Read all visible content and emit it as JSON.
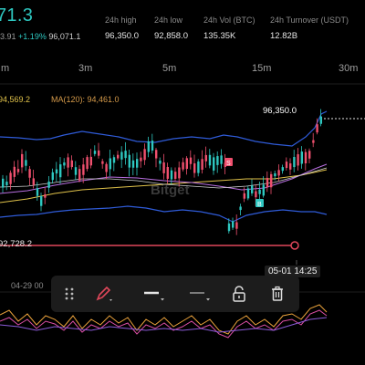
{
  "header": {
    "last_price": "71.3",
    "sub_prefix": "3.91",
    "change_pct": "+1.19%",
    "mark_price": "96,071.1",
    "stats": [
      {
        "label": "24h high",
        "value": "96,350.0"
      },
      {
        "label": "24h low",
        "value": "92,858.0"
      },
      {
        "label": "24h Vol (BTC)",
        "value": "135.35K"
      },
      {
        "label": "24h Turnover (USDT)",
        "value": "12.82B"
      }
    ]
  },
  "timeframes": [
    "m",
    "3m",
    "5m",
    "15m",
    "30m"
  ],
  "indicators": {
    "ma_a": "94,569.2",
    "ma_b": "MA(120): 94,461.0"
  },
  "chart": {
    "high_tag": "96,350.0",
    "low_tag": "92,728.2",
    "crosshair_time": "05-01 14:25",
    "axis_date": "04-29 00",
    "watermark": "Bitget",
    "colors": {
      "up": "#2ec7c0",
      "down": "#f0506e",
      "band": "#2f5bd8",
      "ma_yellow": "#e0c24a",
      "ma_purple": "#b86ee0",
      "line": "#e0475a"
    }
  },
  "toolbar": {
    "icons": [
      "drag-handle-icon",
      "pencil-icon",
      "line-style-icon",
      "dashed-line-icon",
      "lock-icon",
      "trash-icon"
    ]
  }
}
